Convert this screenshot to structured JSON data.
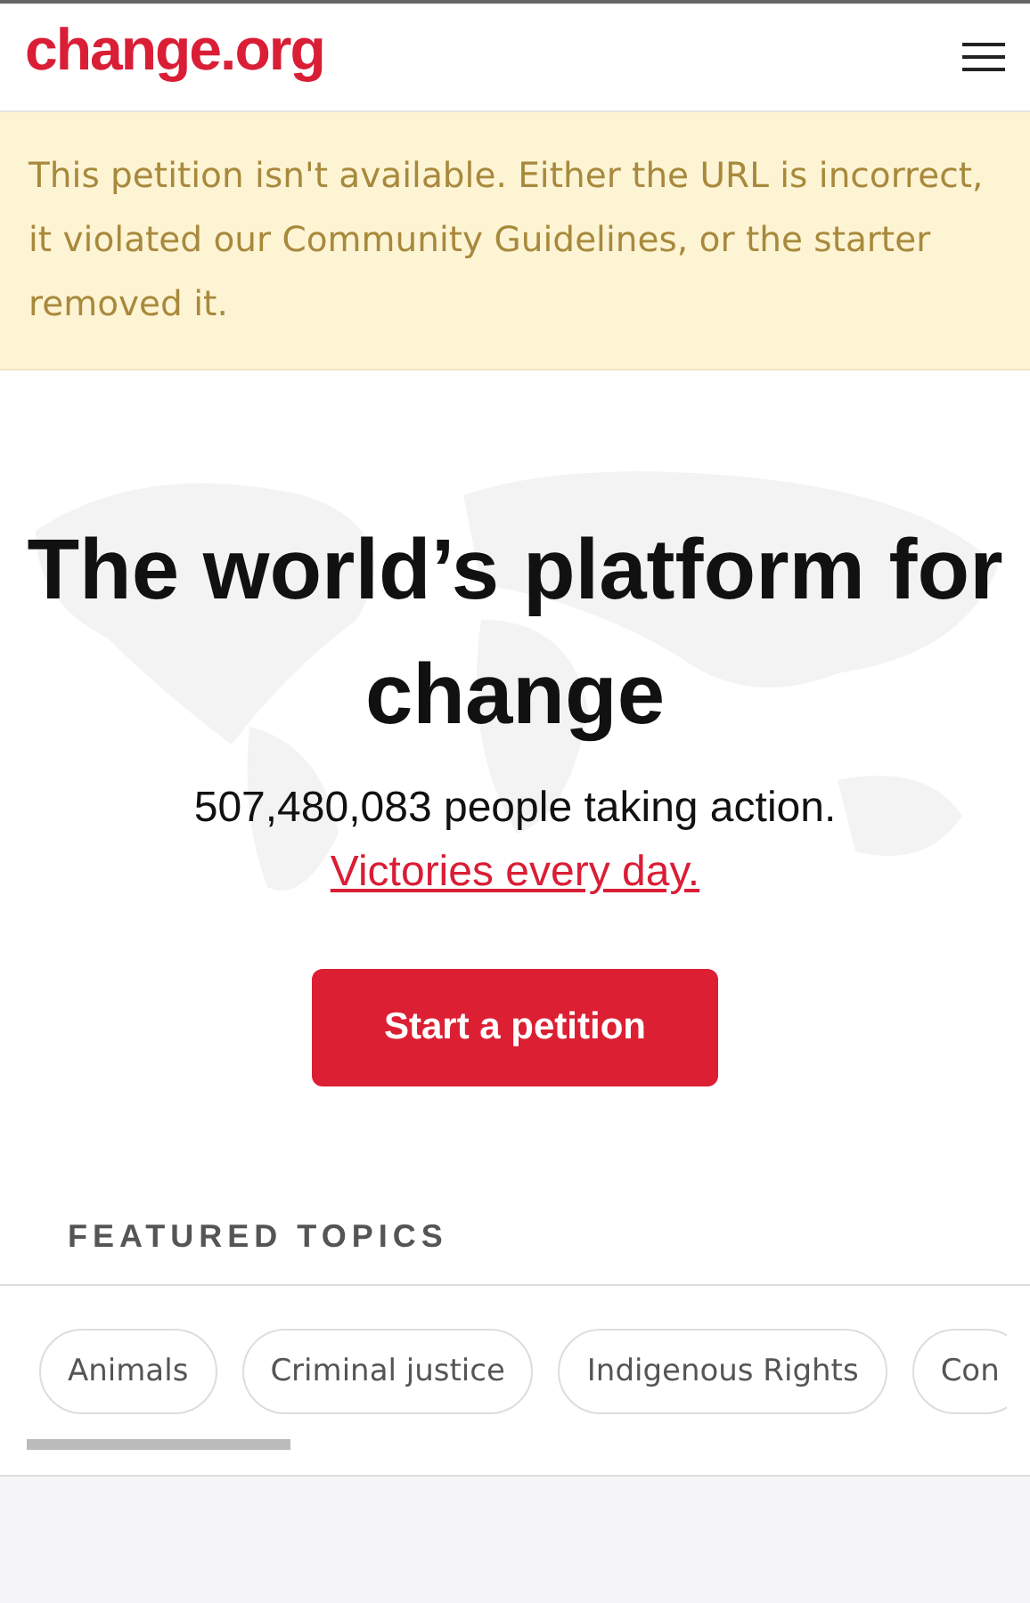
{
  "header": {
    "logo": "change.org"
  },
  "alert": {
    "message": "This petition isn't available. Either the URL is incorrect, it violated our Community Guidelines, or the starter removed it."
  },
  "hero": {
    "title": "The world’s platform for change",
    "count": "507,480,083 people taking action.",
    "link": "Victories every day.",
    "button": "Start a petition"
  },
  "featured_topics": {
    "heading": "FEATURED TOPICS",
    "topics": [
      {
        "label": "Animals"
      },
      {
        "label": "Criminal justice"
      },
      {
        "label": "Indigenous Rights"
      },
      {
        "label": "Con"
      }
    ]
  }
}
